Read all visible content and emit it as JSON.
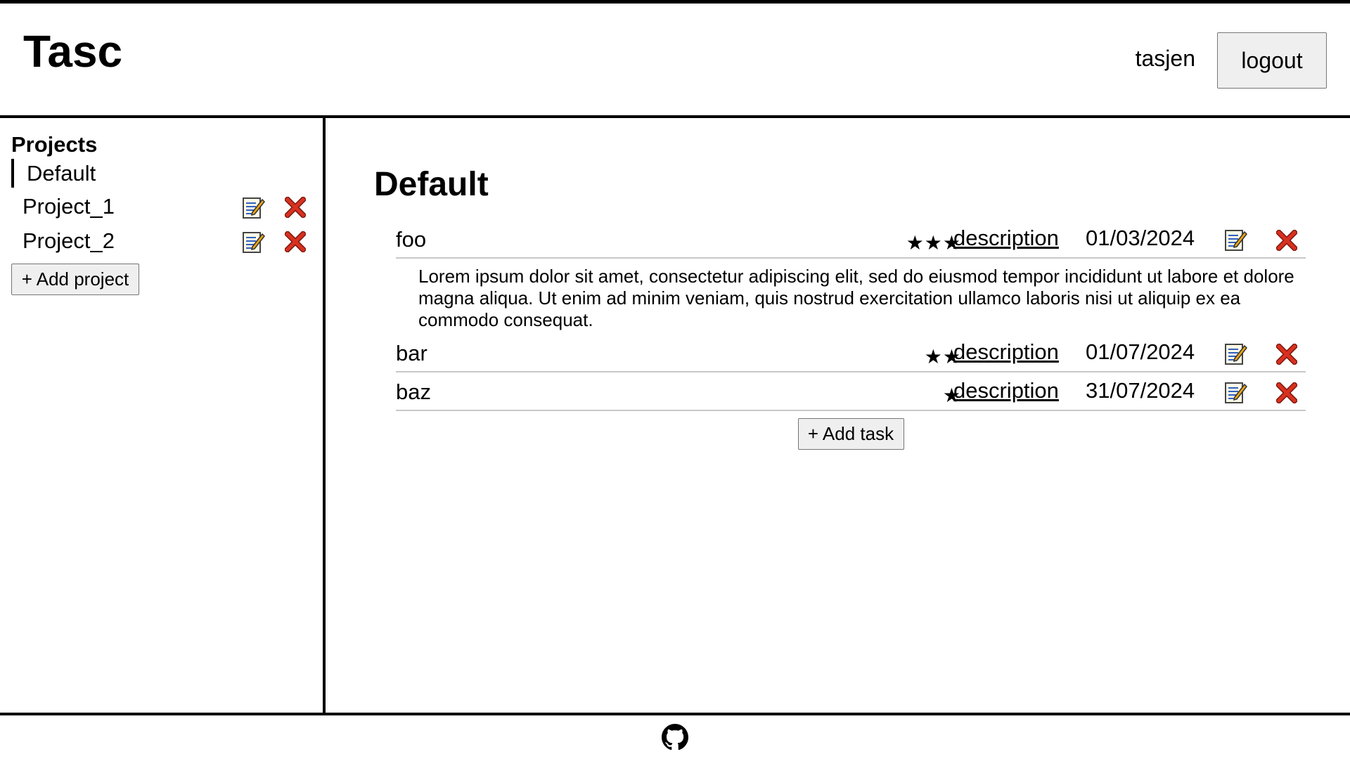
{
  "header": {
    "app_title": "Tasc",
    "username": "tasjen",
    "logout_label": "logout"
  },
  "sidebar": {
    "heading": "Projects",
    "projects": [
      {
        "label": "Default",
        "active": true
      },
      {
        "label": "Project_1",
        "active": false
      },
      {
        "label": "Project_2",
        "active": false
      }
    ],
    "add_project_label": "+ Add project"
  },
  "main": {
    "project_title": "Default",
    "tasks": [
      {
        "name": "foo",
        "priority": "★★★",
        "priority_level": 3,
        "description_link": "description",
        "due_date": "01/03/2024",
        "description": "Lorem ipsum dolor sit amet, consectetur adipiscing elit, sed do eiusmod tempor incididunt ut labore et dolore magna aliqua. Ut enim ad minim veniam, quis nostrud exercitation ullamco laboris nisi ut aliquip ex ea commodo consequat."
      },
      {
        "name": "bar",
        "priority": "★★",
        "priority_level": 2,
        "description_link": "description",
        "due_date": "01/07/2024"
      },
      {
        "name": "baz",
        "priority": "★",
        "priority_level": 1,
        "description_link": "description",
        "due_date": "31/07/2024"
      }
    ],
    "add_task_label": "+ Add task"
  },
  "footer": {
    "github_icon": "github-icon"
  },
  "colors": {
    "delete_red": "#d9301f",
    "delete_outline": "#7a1a10",
    "memo_paper": "#fffbe8",
    "memo_pencil": "#e8a317",
    "button_bg": "#efefef",
    "divider": "#c8c8c8"
  }
}
